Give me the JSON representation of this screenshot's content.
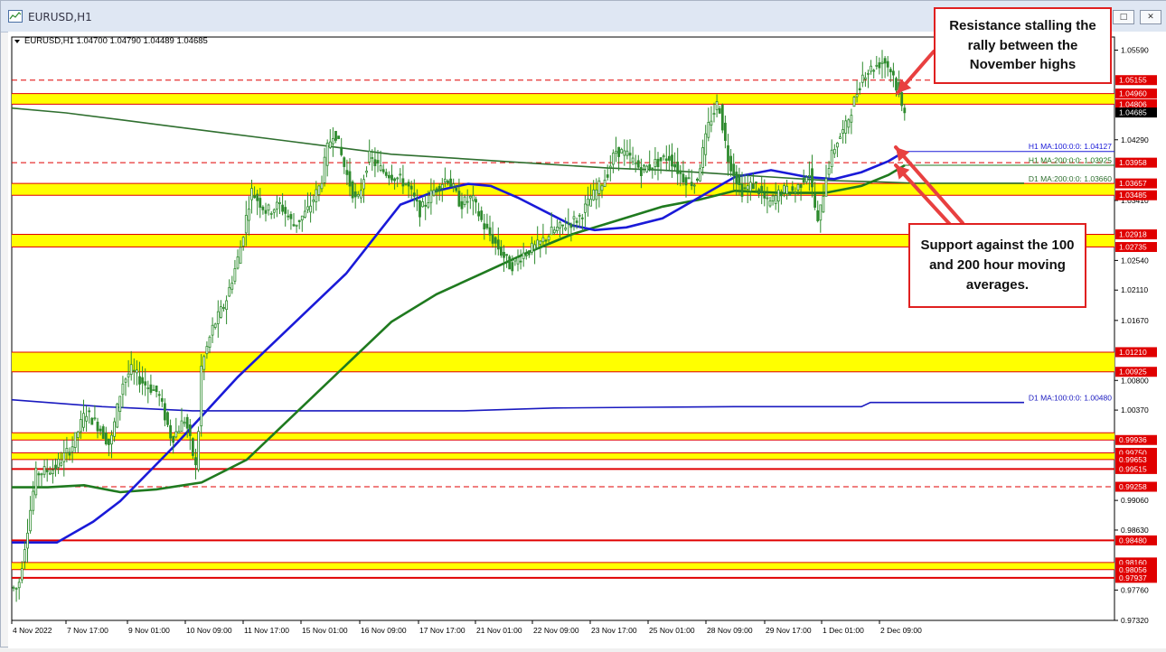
{
  "window": {
    "title": "EURUSD,H1"
  },
  "chart_header": {
    "symbol_info": "EURUSD,H1  1.04700 1.04790 1.04489 1.04685"
  },
  "annotations": {
    "resistance": "Resistance stalling the rally between the November highs",
    "support": "Support against the 100 and 200 hour moving averages."
  },
  "colors": {
    "price": "#2e8b2e",
    "ma100_h1": "#1a1ad8",
    "ma200_h1": "#1f7a1f",
    "ma200_d1": "#2f6f2f",
    "ma100_d1": "#1a1ac0",
    "zone": "#ffff00",
    "level_line": "#e00000",
    "arrow": "#e84040"
  },
  "chart_data": {
    "type": "candlestick",
    "symbol": "EURUSD",
    "timeframe": "H1",
    "ohlc_current": {
      "open": 1.047,
      "high": 1.0479,
      "low": 1.04489,
      "close": 1.04685
    },
    "x_tick_labels": [
      "4 Nov 2022",
      "7 Nov 17:00",
      "9 Nov 01:00",
      "10 Nov 09:00",
      "11 Nov 17:00",
      "15 Nov 01:00",
      "16 Nov 09:00",
      "17 Nov 17:00",
      "21 Nov 01:00",
      "22 Nov 09:00",
      "23 Nov 17:00",
      "25 Nov 01:00",
      "28 Nov 09:00",
      "29 Nov 17:00",
      "1 Dec 01:00",
      "2 Dec 09:00"
    ],
    "y_tick_labels": [
      "1.05590",
      "1.04290",
      "1.03410",
      "1.02540",
      "1.02110",
      "1.01670",
      "1.00800",
      "1.00370",
      "0.99060",
      "0.98630",
      "0.97760",
      "0.97320"
    ],
    "ylim": [
      0.9732,
      1.0578
    ],
    "price_level_labels": [
      "1.05155",
      "1.04960",
      "1.04806",
      "1.04685",
      "1.03958",
      "1.03657",
      "1.03485",
      "1.02918",
      "1.02735",
      "1.01210",
      "1.00925",
      "0.99936",
      "0.99750",
      "0.99653",
      "0.99515",
      "0.99258",
      "0.98480",
      "0.98160",
      "0.98056",
      "0.97937"
    ],
    "zones": [
      [
        1.04806,
        1.0496
      ],
      [
        1.03485,
        1.03657
      ],
      [
        1.02735,
        1.02918
      ],
      [
        1.00925,
        1.0121
      ],
      [
        0.99936,
        1.0004
      ],
      [
        0.99653,
        0.9975
      ],
      [
        0.98056,
        0.9816
      ]
    ],
    "solid_levels": [
      0.99515,
      0.9848,
      0.97937
    ],
    "dashed_levels": [
      1.05155,
      1.03958,
      0.99258
    ],
    "ma_labels": {
      "ma100_h1": "H1 MA:100:0:0: 1.04127",
      "ma200_h1": "H1 MA:200:0:0: 1.03925",
      "ma200_d1": "D1 MA:200:0:0: 1.03660",
      "ma100_d1": "D1 MA:100:0:0: 1.00480"
    },
    "price_path": [
      [
        0,
        0.978
      ],
      [
        10,
        0.9778
      ],
      [
        18,
        0.9845
      ],
      [
        30,
        0.9945
      ],
      [
        50,
        0.9952
      ],
      [
        70,
        0.9985
      ],
      [
        85,
        1.0035
      ],
      [
        100,
        1.0012
      ],
      [
        112,
        0.9985
      ],
      [
        125,
        1.0075
      ],
      [
        135,
        1.0095
      ],
      [
        150,
        1.0075
      ],
      [
        165,
        1.0062
      ],
      [
        180,
        0.9995
      ],
      [
        195,
        1.0025
      ],
      [
        208,
        0.9945
      ],
      [
        212,
        1.0095
      ],
      [
        225,
        1.0155
      ],
      [
        240,
        1.0195
      ],
      [
        255,
        1.0265
      ],
      [
        268,
        1.0355
      ],
      [
        285,
        1.0325
      ],
      [
        300,
        1.0335
      ],
      [
        315,
        1.0305
      ],
      [
        330,
        1.0325
      ],
      [
        345,
        1.0365
      ],
      [
        352,
        1.0415
      ],
      [
        360,
        1.0445
      ],
      [
        372,
        1.0385
      ],
      [
        385,
        1.0335
      ],
      [
        398,
        1.0405
      ],
      [
        412,
        1.0385
      ],
      [
        428,
        1.0375
      ],
      [
        440,
        1.0365
      ],
      [
        455,
        1.0325
      ],
      [
        470,
        1.0355
      ],
      [
        485,
        1.0375
      ],
      [
        500,
        1.0335
      ],
      [
        512,
        1.0345
      ],
      [
        525,
        1.0305
      ],
      [
        540,
        1.0275
      ],
      [
        555,
        1.0245
      ],
      [
        570,
        1.0265
      ],
      [
        585,
        1.0275
      ],
      [
        600,
        1.0295
      ],
      [
        615,
        1.0305
      ],
      [
        630,
        1.0315
      ],
      [
        645,
        1.0345
      ],
      [
        660,
        1.0375
      ],
      [
        672,
        1.0415
      ],
      [
        685,
        1.0405
      ],
      [
        700,
        1.0385
      ],
      [
        715,
        1.0395
      ],
      [
        730,
        1.0405
      ],
      [
        745,
        1.0375
      ],
      [
        760,
        1.0365
      ],
      [
        775,
        1.0455
      ],
      [
        785,
        1.0485
      ],
      [
        795,
        1.0405
      ],
      [
        810,
        1.0355
      ],
      [
        825,
        1.0365
      ],
      [
        840,
        1.0335
      ],
      [
        855,
        1.0355
      ],
      [
        870,
        1.0355
      ],
      [
        885,
        1.0385
      ],
      [
        895,
        1.0305
      ],
      [
        905,
        1.0385
      ],
      [
        915,
        1.0425
      ],
      [
        925,
        1.0445
      ],
      [
        935,
        1.0485
      ],
      [
        945,
        1.0525
      ],
      [
        958,
        1.0535
      ],
      [
        968,
        1.0545
      ],
      [
        978,
        1.0525
      ],
      [
        988,
        1.0475
      ]
    ],
    "ma100_h1": [
      [
        0,
        0.9845
      ],
      [
        50,
        0.9845
      ],
      [
        90,
        0.9875
      ],
      [
        120,
        0.9905
      ],
      [
        150,
        0.9945
      ],
      [
        180,
        0.9985
      ],
      [
        215,
        1.0035
      ],
      [
        250,
        1.0085
      ],
      [
        290,
        1.0135
      ],
      [
        330,
        1.0185
      ],
      [
        370,
        1.0235
      ],
      [
        400,
        1.0285
      ],
      [
        430,
        1.0335
      ],
      [
        470,
        1.0355
      ],
      [
        505,
        1.0365
      ],
      [
        530,
        1.0362
      ],
      [
        560,
        1.0345
      ],
      [
        590,
        1.0325
      ],
      [
        620,
        1.0305
      ],
      [
        645,
        1.0298
      ],
      [
        680,
        1.0302
      ],
      [
        720,
        1.0315
      ],
      [
        760,
        1.0345
      ],
      [
        800,
        1.0375
      ],
      [
        840,
        1.0385
      ],
      [
        880,
        1.0375
      ],
      [
        910,
        1.0372
      ],
      [
        940,
        1.0382
      ],
      [
        970,
        1.0398
      ],
      [
        988,
        1.0412
      ]
    ],
    "ma200_h1": [
      [
        0,
        0.9925
      ],
      [
        40,
        0.9925
      ],
      [
        80,
        0.9928
      ],
      [
        120,
        0.9918
      ],
      [
        160,
        0.9922
      ],
      [
        210,
        0.9932
      ],
      [
        260,
        0.9965
      ],
      [
        300,
        1.0015
      ],
      [
        340,
        1.0065
      ],
      [
        380,
        1.0115
      ],
      [
        420,
        1.0165
      ],
      [
        470,
        1.0205
      ],
      [
        520,
        1.0235
      ],
      [
        570,
        1.0265
      ],
      [
        620,
        1.0292
      ],
      [
        670,
        1.0312
      ],
      [
        720,
        1.0332
      ],
      [
        760,
        1.0342
      ],
      [
        800,
        1.0355
      ],
      [
        850,
        1.0352
      ],
      [
        900,
        1.0352
      ],
      [
        940,
        1.0362
      ],
      [
        970,
        1.0378
      ],
      [
        988,
        1.0392
      ]
    ],
    "ma200_d1": [
      [
        0,
        1.0475
      ],
      [
        60,
        1.0468
      ],
      [
        120,
        1.0458
      ],
      [
        180,
        1.0448
      ],
      [
        240,
        1.0438
      ],
      [
        300,
        1.0428
      ],
      [
        360,
        1.0418
      ],
      [
        420,
        1.0408
      ],
      [
        480,
        1.0403
      ],
      [
        540,
        1.0398
      ],
      [
        600,
        1.0393
      ],
      [
        660,
        1.0388
      ],
      [
        720,
        1.0385
      ],
      [
        780,
        1.038
      ],
      [
        840,
        1.0375
      ],
      [
        900,
        1.037
      ],
      [
        960,
        1.0368
      ],
      [
        1000,
        1.0366
      ],
      [
        1120,
        1.0366
      ]
    ],
    "ma100_d1": [
      [
        0,
        1.0052
      ],
      [
        100,
        1.0042
      ],
      [
        200,
        1.0036
      ],
      [
        300,
        1.0036
      ],
      [
        400,
        1.0036
      ],
      [
        500,
        1.0036
      ],
      [
        600,
        1.004
      ],
      [
        700,
        1.0041
      ],
      [
        800,
        1.0042
      ],
      [
        900,
        1.0042
      ],
      [
        940,
        1.0042
      ],
      [
        950,
        1.0048
      ],
      [
        1120,
        1.0048
      ]
    ]
  }
}
